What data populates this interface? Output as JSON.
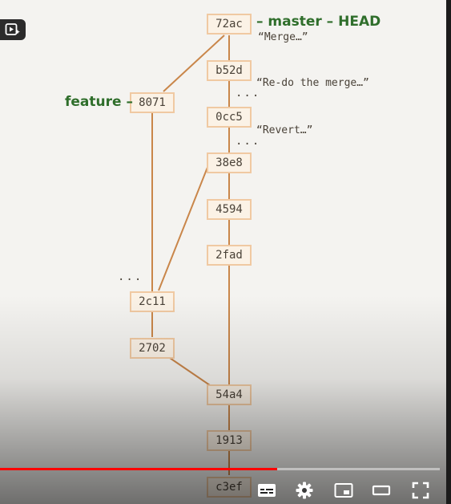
{
  "commits": {
    "c72ac": "72ac",
    "cb52d": "b52d",
    "c0cc5": "0cc5",
    "c38e8": "38e8",
    "c4594": "4594",
    "c2fad": "2fad",
    "c8071": "8071",
    "c2c11": "2c11",
    "c2702": "2702",
    "c54a4": "54a4",
    "c1913": "1913",
    "cc3ef": "c3ef"
  },
  "refs": {
    "master": "– master – HEAD",
    "feature": "feature –"
  },
  "messages": {
    "merge": "“Merge…”",
    "redo": "“Re-do the merge…”",
    "revert": "“Revert…”"
  },
  "ellipsis": "...",
  "colors": {
    "line": "#c9864a",
    "box_border": "#f0c9a2",
    "box_fill": "#fbf2e6",
    "ref_text": "#2f6e2b",
    "progress": "#ff0000"
  },
  "player": {
    "progress_fraction": 0.63,
    "icons": [
      "queue-icon",
      "captions-icon",
      "settings-gear-icon",
      "miniplayer-icon",
      "theater-mode-icon",
      "fullscreen-icon"
    ]
  }
}
